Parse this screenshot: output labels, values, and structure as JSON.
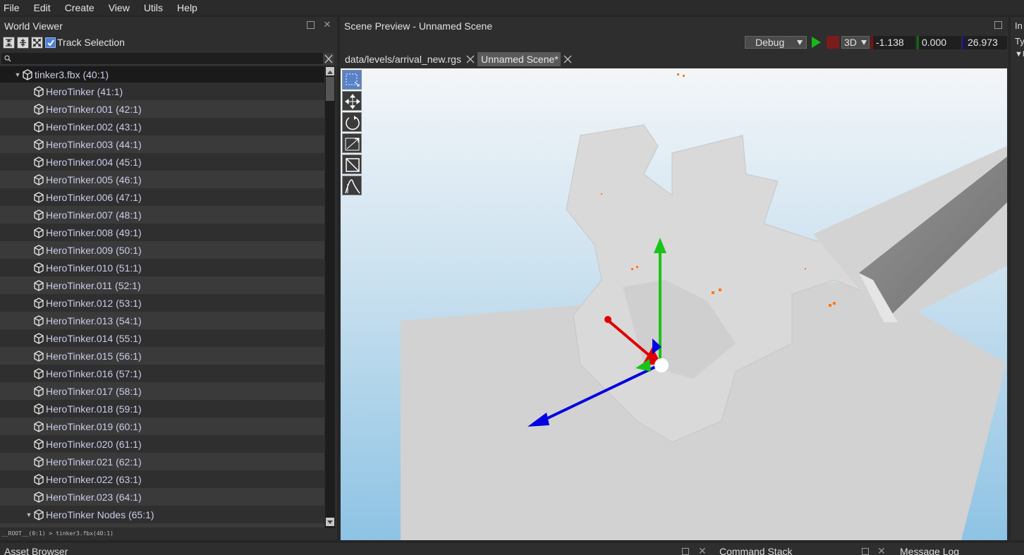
{
  "menu": [
    "File",
    "Edit",
    "Create",
    "View",
    "Utils",
    "Help"
  ],
  "world_viewer": {
    "title": "World Viewer",
    "track_selection_label": "Track Selection",
    "track_selection_checked": true,
    "search_placeholder": "",
    "root": "tinker3.fbx (40:1)",
    "items": [
      "HeroTinker (41:1)",
      "HeroTinker.001 (42:1)",
      "HeroTinker.002 (43:1)",
      "HeroTinker.003 (44:1)",
      "HeroTinker.004 (45:1)",
      "HeroTinker.005 (46:1)",
      "HeroTinker.006 (47:1)",
      "HeroTinker.007 (48:1)",
      "HeroTinker.008 (49:1)",
      "HeroTinker.009 (50:1)",
      "HeroTinker.010 (51:1)",
      "HeroTinker.011 (52:1)",
      "HeroTinker.012 (53:1)",
      "HeroTinker.013 (54:1)",
      "HeroTinker.014 (55:1)",
      "HeroTinker.015 (56:1)",
      "HeroTinker.016 (57:1)",
      "HeroTinker.017 (58:1)",
      "HeroTinker.018 (59:1)",
      "HeroTinker.019 (60:1)",
      "HeroTinker.020 (61:1)",
      "HeroTinker.021 (62:1)",
      "HeroTinker.022 (63:1)",
      "HeroTinker.023 (64:1)"
    ],
    "group": "HeroTinker Nodes (65:1)",
    "path": "__ROOT__(0:1) > tinker3.fbx(40:1)"
  },
  "scene_preview": {
    "title": "Scene Preview - Unnamed Scene",
    "mode": "Debug",
    "view": "3D",
    "coord_x": "-1.138",
    "coord_y": "0.000",
    "coord_z": "26.973",
    "tabs": [
      "data/levels/arrival_new.rgs",
      "Unnamed Scene*"
    ],
    "active_tab": 1,
    "tools": [
      "select-tool-icon",
      "move-tool-icon",
      "rotate-tool-icon",
      "scale-tool-icon",
      "bounds-tool-icon",
      "curve-tool-icon"
    ]
  },
  "inspector": {
    "title_fragment": "In",
    "type_fragment": "Ty",
    "row_fragment": "E"
  },
  "bottom": {
    "asset_browser": "Asset Browser",
    "command_stack": "Command Stack",
    "message_log": "Message Log"
  },
  "colors": {
    "accent": "#4d7fd6",
    "axis_x": "#e00000",
    "axis_y": "#19c419",
    "axis_z": "#0000e0",
    "play": "#18b818",
    "stop": "#7a1c1c"
  }
}
